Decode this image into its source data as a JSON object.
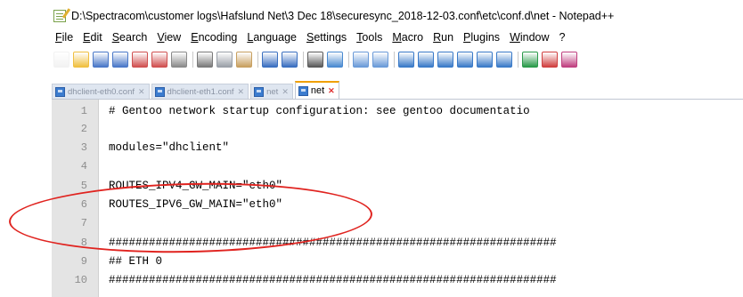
{
  "window": {
    "title": "D:\\Spectracom\\customer logs\\Hafslund Net\\3 Dec 18\\securesync_2018-12-03.conf\\etc\\conf.d\\net - Notepad++"
  },
  "menu": [
    "File",
    "Edit",
    "Search",
    "View",
    "Encoding",
    "Language",
    "Settings",
    "Tools",
    "Macro",
    "Run",
    "Plugins",
    "Window",
    "?"
  ],
  "toolbar": {
    "buttons": [
      {
        "icon": "new-file-icon",
        "color": "#f2f2f2"
      },
      {
        "icon": "open-file-icon",
        "color": "#f0c040"
      },
      {
        "icon": "save-icon",
        "color": "#4a78c8"
      },
      {
        "icon": "save-all-icon",
        "color": "#4a78c8"
      },
      {
        "icon": "close-icon",
        "color": "#d05050"
      },
      {
        "icon": "close-all-icon",
        "color": "#d05050"
      },
      {
        "icon": "print-icon",
        "color": "#8a8a8a"
      },
      {
        "icon": "cut-icon",
        "color": "#7a7a7a"
      },
      {
        "icon": "copy-icon",
        "color": "#9aa0a8"
      },
      {
        "icon": "paste-icon",
        "color": "#c8a060"
      },
      {
        "icon": "undo-icon",
        "color": "#3a6fc0"
      },
      {
        "icon": "redo-icon",
        "color": "#3a6fc0"
      },
      {
        "icon": "find-icon",
        "color": "#5a5a5a"
      },
      {
        "icon": "replace-icon",
        "color": "#4a8ad0"
      },
      {
        "icon": "zoom-in-icon",
        "color": "#6a9ad8"
      },
      {
        "icon": "zoom-out-icon",
        "color": "#6a9ad8"
      },
      {
        "icon": "sync-vertical-icon",
        "color": "#3a7ac8"
      },
      {
        "icon": "sync-horizontal-icon",
        "color": "#3a7ac8"
      },
      {
        "icon": "word-wrap-icon",
        "color": "#3a7ac8"
      },
      {
        "icon": "show-all-chars-icon",
        "color": "#3a7ac8"
      },
      {
        "icon": "indent-guide-icon",
        "color": "#3a7ac8"
      },
      {
        "icon": "function-list-icon",
        "color": "#3a7ac8"
      },
      {
        "icon": "document-map-icon",
        "color": "#2a9a4a"
      },
      {
        "icon": "record-macro-icon",
        "color": "#d04040"
      },
      {
        "icon": "stop-macro-icon",
        "color": "#c04080"
      }
    ]
  },
  "tabs": [
    {
      "label": "dhclient-eth0.conf",
      "active": false
    },
    {
      "label": "dhclient-eth1.conf",
      "active": false
    },
    {
      "label": "net",
      "active": false
    },
    {
      "label": "net",
      "active": true
    }
  ],
  "editor": {
    "lines": [
      {
        "number": "1",
        "text": "# Gentoo network startup configuration: see gentoo documentatio"
      },
      {
        "number": "2",
        "text": ""
      },
      {
        "number": "3",
        "text": "modules=\"dhclient\""
      },
      {
        "number": "4",
        "text": ""
      },
      {
        "number": "5",
        "text": "ROUTES_IPV4_GW_MAIN=\"eth0\""
      },
      {
        "number": "6",
        "text": "ROUTES_IPV6_GW_MAIN=\"eth0\""
      },
      {
        "number": "7",
        "text": ""
      },
      {
        "number": "8",
        "text": "###################################################################"
      },
      {
        "number": "9",
        "text": "## ETH 0"
      },
      {
        "number": "10",
        "text": "###################################################################"
      }
    ]
  },
  "colors": {
    "highlight": "#e0231f",
    "active_tab_accent": "#f0a000"
  }
}
